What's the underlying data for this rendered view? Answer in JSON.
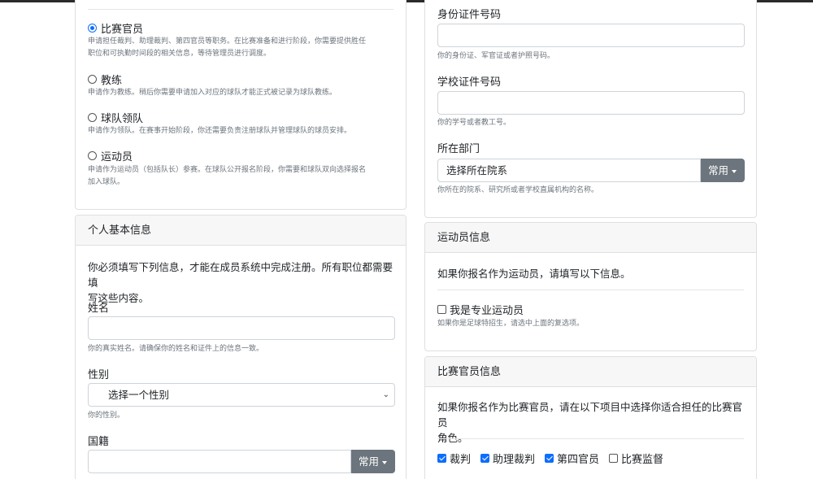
{
  "roles": [
    {
      "label": "比赛官员",
      "checked": true,
      "desc": [
        "申请担任裁判、助理裁判、第四官员等职务。在比赛准备和进行阶段，你需要提供胜任",
        "职位和可执勤时间段的相关信息，等待管理员进行调度。"
      ]
    },
    {
      "label": "教练",
      "checked": false,
      "desc": [
        "申请作为教练。稍后你需要申请加入对应的球队才能正式被记录为球队教练。"
      ]
    },
    {
      "label": "球队领队",
      "checked": false,
      "desc": [
        "申请作为领队。在赛事开始阶段，你还需要负责注册球队并管理球队的球员安排。"
      ]
    },
    {
      "label": "运动员",
      "checked": false,
      "desc": [
        "申请作为运动员（包括队长）参赛。在球队公开报名阶段，你需要和球队双向选择报名",
        "加入球队。"
      ]
    }
  ],
  "personal": {
    "header": "个人基本信息",
    "intro": [
      "你必须填写下列信息，才能在成员系统中完成注册。所有职位都需要填",
      "写这些内容。"
    ],
    "name_label": "姓名",
    "name_help": "你的真实姓名。请确保你的姓名和证件上的信息一致。",
    "gender_label": "性别",
    "gender_value": "选择一个性别",
    "gender_help": "你的性别。",
    "nationality_label": "国籍",
    "nationality_btn": "常用"
  },
  "id_section": {
    "id_label": "身份证件号码",
    "id_help": "你的身份证、军官证或者护照号码。",
    "school_id_label": "学校证件号码",
    "school_id_help": "你的学号或者教工号。",
    "dept_label": "所在部门",
    "dept_value": "选择所在院系",
    "dept_btn": "常用",
    "dept_help": "你所在的院系、研究所或者学校直属机构的名称。"
  },
  "athlete": {
    "header": "运动员信息",
    "intro": "如果你报名作为运动员，请填写以下信息。",
    "pro_label": "我是专业运动员",
    "pro_help": "如果你是足球特招生，请选中上面的复选项。"
  },
  "official": {
    "header": "比赛官员信息",
    "intro": [
      "如果你报名作为比赛官员，请在以下项目中选择你适合担任的比赛官员",
      "角色。"
    ],
    "options": [
      {
        "label": "裁判",
        "checked": true
      },
      {
        "label": "助理裁判",
        "checked": true
      },
      {
        "label": "第四官员",
        "checked": true
      },
      {
        "label": "比赛监督",
        "checked": false
      }
    ]
  }
}
